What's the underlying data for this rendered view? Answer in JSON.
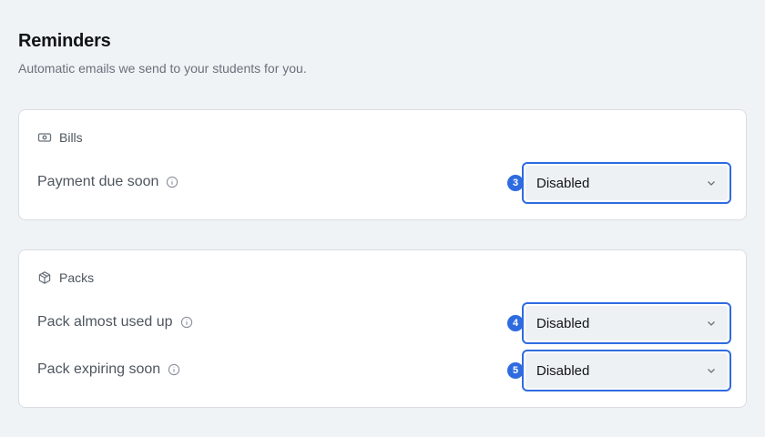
{
  "header": {
    "title": "Reminders",
    "subtitle": "Automatic emails we send to your students for you."
  },
  "sections": [
    {
      "title": "Bills",
      "icon": "banknote-icon",
      "rows": [
        {
          "label": "Payment due soon",
          "value": "Disabled",
          "badge": "3"
        }
      ]
    },
    {
      "title": "Packs",
      "icon": "package-icon",
      "rows": [
        {
          "label": "Pack almost used up",
          "value": "Disabled",
          "badge": "4"
        },
        {
          "label": "Pack expiring soon",
          "value": "Disabled",
          "badge": "5"
        }
      ]
    }
  ],
  "colors": {
    "accent": "#2f6be0",
    "background": "#f0f3f6",
    "select_fill": "#eef1f4"
  }
}
